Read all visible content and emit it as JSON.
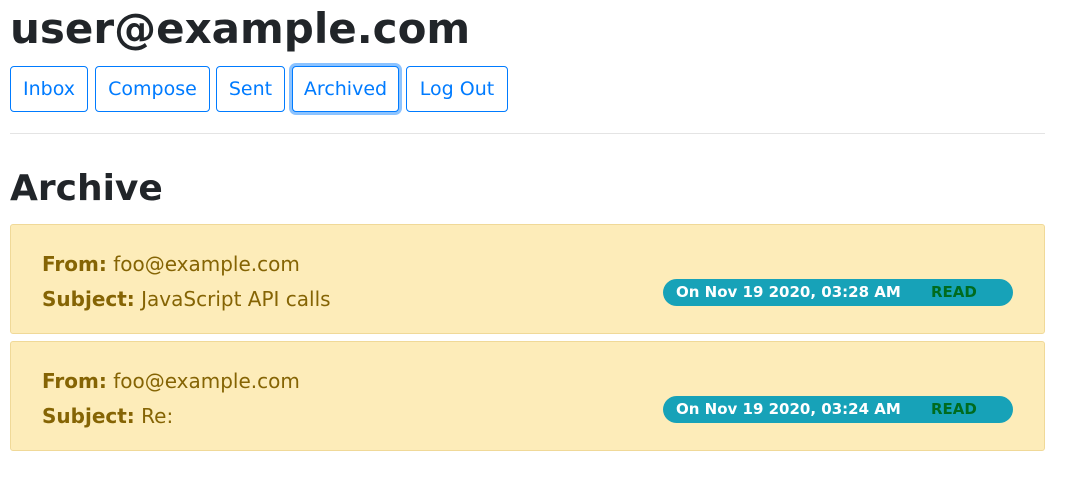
{
  "user": {
    "email": "user@example.com"
  },
  "nav": {
    "buttons": [
      {
        "label": "Inbox"
      },
      {
        "label": "Compose"
      },
      {
        "label": "Sent"
      },
      {
        "label": "Archived"
      },
      {
        "label": "Log Out"
      }
    ]
  },
  "mailbox": {
    "title": "Archive"
  },
  "emails": [
    {
      "from_label": "From:",
      "from": "foo@example.com",
      "subject_label": "Subject:",
      "subject": "JavaScript API calls",
      "timestamp": "On Nov 19 2020, 03:28 AM",
      "status": "READ"
    },
    {
      "from_label": "From:",
      "from": "foo@example.com",
      "subject_label": "Subject:",
      "subject": "Re:",
      "timestamp": "On Nov 19 2020, 03:24 AM",
      "status": "READ"
    }
  ],
  "colors": {
    "primary": "#007bff",
    "card_bg": "#fdecb9",
    "card_text": "#856404",
    "badge_bg": "#17a2b8",
    "read_text": "#006b1f"
  }
}
